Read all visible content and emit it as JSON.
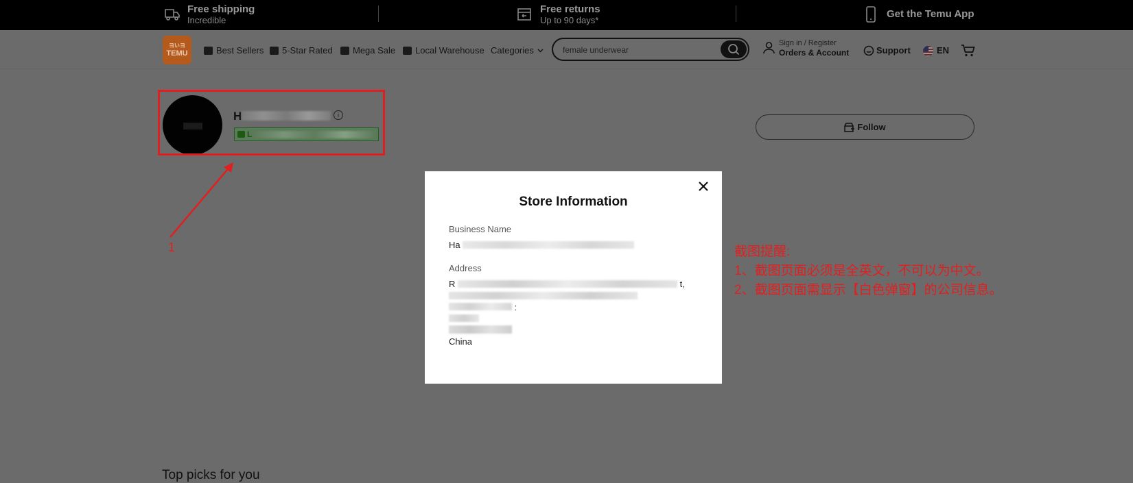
{
  "promo": {
    "shipping_title": "Free shipping",
    "shipping_sub": "Incredible",
    "returns_title": "Free returns",
    "returns_sub": "Up to 90 days*",
    "app_text": "Get the Temu App"
  },
  "header": {
    "logo_top": "ヨいヨ",
    "logo_text": "TEMU",
    "nav": [
      "Best Sellers",
      "5-Star Rated",
      "Mega Sale",
      "Local Warehouse",
      "Categories"
    ],
    "search_value": "female underwear",
    "account_line1": "Sign in / Register",
    "account_line2": "Orders & Account",
    "support": "Support",
    "lang": "EN"
  },
  "store": {
    "name_initial": "H",
    "tag_initial": "L",
    "follow_label": "Follow"
  },
  "modal": {
    "title": "Store Information",
    "business_label": "Business Name",
    "business_initial": "Ha",
    "address_label": "Address",
    "address_line1_initial": "R",
    "address_line1_end": "t,",
    "address_line3_end": ":",
    "address_country": "China"
  },
  "annotation": {
    "arrow_number": "1",
    "note_title": "截图提醒:",
    "note_line1": "1、截图页面必须是全英文，不可以为中文。",
    "note_line2": "2、截图页面需显示【白色弹窗】的公司信息。"
  },
  "section_title": "Top picks for you",
  "colors": {
    "annotation_red": "#e02020",
    "overlay": "#6b6b6b",
    "modal_bg": "#ffffff"
  }
}
